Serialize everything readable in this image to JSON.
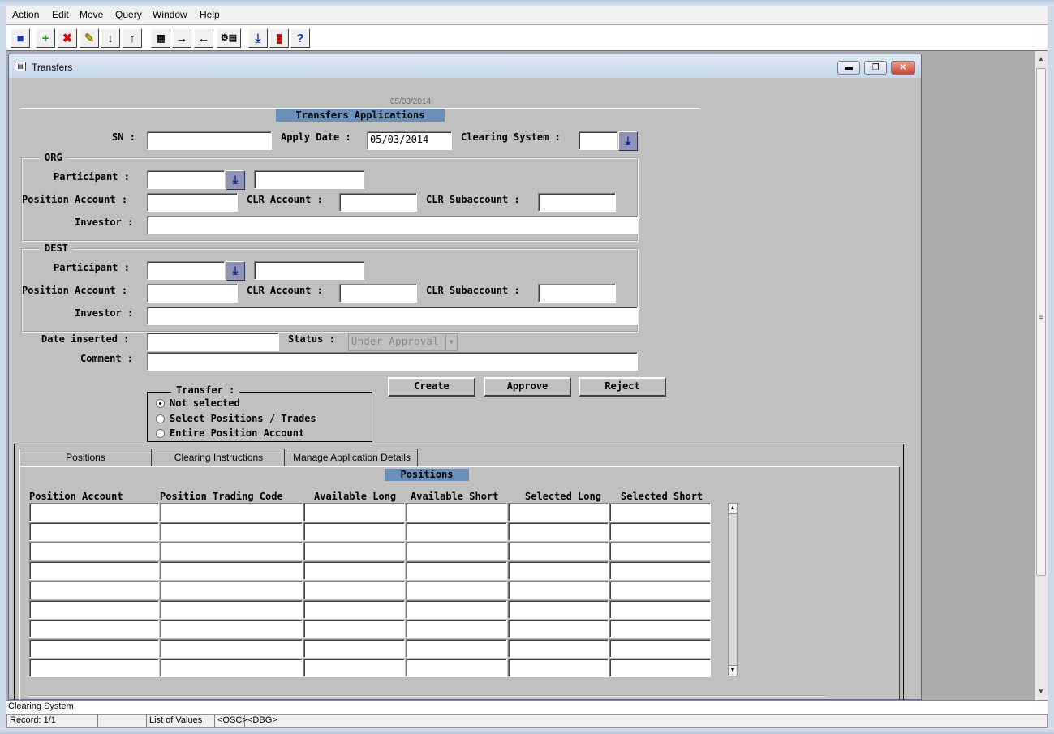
{
  "menu": [
    {
      "label": "Action",
      "underline": "A"
    },
    {
      "label": "Edit",
      "underline": "E"
    },
    {
      "label": "Move",
      "underline": "M"
    },
    {
      "label": "Query",
      "underline": "Q"
    },
    {
      "label": "Window",
      "underline": "W"
    },
    {
      "label": "Help",
      "underline": "H"
    }
  ],
  "toolbar": {
    "save": "save-icon",
    "insert": "insert-record-icon",
    "delete": "delete-record-icon",
    "clear": "clear-icon",
    "down": "arrow-down-icon",
    "up": "arrow-up-icon",
    "query": "query-icon",
    "next": "arrow-right-icon",
    "prev": "arrow-left-icon",
    "lov": "list-of-values-icon",
    "download": "download-icon",
    "exit": "exit-icon",
    "help": "help-icon"
  },
  "window": {
    "title": "Transfers"
  },
  "form": {
    "date_stamp": "05/03/2014",
    "title": "Transfers Applications",
    "sn_label": "SN :",
    "apply_date_label": "Apply Date :",
    "apply_date_value": "05/03/2014",
    "clearing_system_label": "Clearing System :",
    "org": {
      "title": "ORG",
      "participant_label": "Participant :",
      "position_account_label": "Position Account :",
      "clr_account_label": "CLR Account :",
      "clr_subaccount_label": "CLR Subaccount :",
      "investor_label": "Investor :"
    },
    "dest": {
      "title": "DEST",
      "participant_label": "Participant :",
      "position_account_label": "Position Account :",
      "clr_account_label": "CLR Account :",
      "clr_subaccount_label": "CLR Subaccount :",
      "investor_label": "Investor :"
    },
    "date_inserted_label": "Date inserted :",
    "status_label": "Status :",
    "status_value": "Under Approval",
    "comment_label": "Comment :",
    "buttons": {
      "create": "Create",
      "approve": "Approve",
      "reject": "Reject"
    },
    "transfer": {
      "title": "Transfer :",
      "options": [
        "Not selected",
        "Select Positions / Trades",
        "Entire Position Account"
      ],
      "selected": 0
    }
  },
  "tabs": {
    "items": [
      "Positions",
      "Clearing Instructions",
      "Manage Application Details"
    ],
    "active": 0
  },
  "positions": {
    "title": "Positions",
    "columns": [
      "Position Account",
      "Position Trading Code",
      "Available Long",
      "Available Short",
      "Selected Long",
      "Selected Short"
    ],
    "row_count": 9
  },
  "statusbar": {
    "message": "Clearing System",
    "record": "Record: 1/1",
    "segment2": "",
    "lov": "List of Values",
    "osc": "<OSC>",
    "dbg": "<DBG>"
  }
}
